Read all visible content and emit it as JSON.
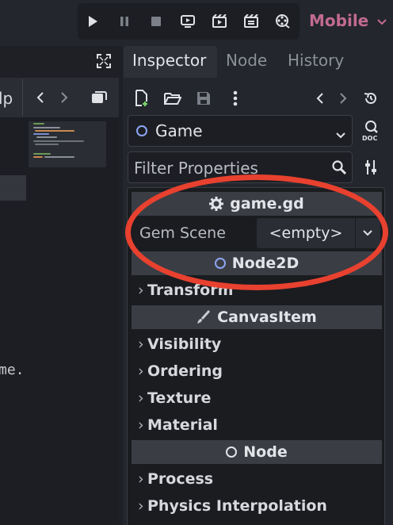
{
  "toolbar": {
    "run_icons": [
      "play-icon",
      "pause-icon",
      "stop-icon",
      "remote-debug-icon",
      "play-scene-icon",
      "play-custom-scene-icon",
      "movie-maker-icon"
    ],
    "renderer_label": "Mobile"
  },
  "left_panel": {
    "help_fragment": "lp",
    "code_fragment": "me."
  },
  "dock": {
    "tabs": [
      "Inspector",
      "Node",
      "History"
    ]
  },
  "inspector": {
    "object_name": "Game",
    "filter_placeholder": "Filter Properties",
    "script_section": "game.gd",
    "gem_scene_label": "Gem Scene",
    "gem_scene_value": "<empty>",
    "node2d_section": "Node2D",
    "transform_label": "Transform",
    "canvasitem_section": "CanvasItem",
    "groups_canvasitem": [
      "Visibility",
      "Ordering",
      "Texture",
      "Material"
    ],
    "node_section": "Node",
    "groups_node": [
      "Process",
      "Physics Interpolation"
    ]
  },
  "colors": {
    "accent_renderer": "#c26a93",
    "annotation_circle": "#e8412f",
    "node_circle": "#8da5f3"
  }
}
